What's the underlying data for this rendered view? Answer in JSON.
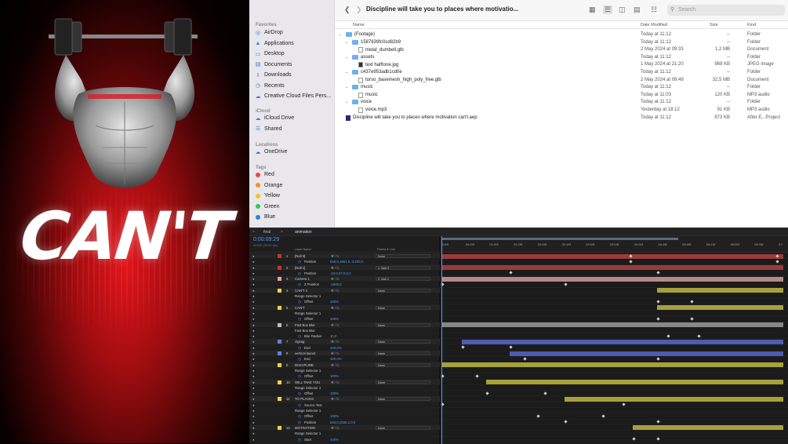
{
  "preview": {
    "headline": "CAN'T"
  },
  "finder": {
    "title": "Discipline will take you to places where motivatio...",
    "search_placeholder": "Search",
    "sidebar": {
      "favorites_label": "Favorites",
      "favorites": [
        "AirDrop",
        "Applications",
        "Desktop",
        "Documents",
        "Downloads",
        "Recents",
        "Creative Cloud Files Pers..."
      ],
      "icloud_label": "iCloud",
      "icloud": [
        "iCloud Drive",
        "Shared"
      ],
      "locations_label": "Locations",
      "locations": [
        "OneDrive"
      ],
      "tags_label": "Tags",
      "tags": [
        {
          "name": "Red",
          "color": "#f0453a"
        },
        {
          "name": "Orange",
          "color": "#f7931e"
        },
        {
          "name": "Yellow",
          "color": "#f5c518"
        },
        {
          "name": "Green",
          "color": "#34c759"
        },
        {
          "name": "Blue",
          "color": "#2f7fe0"
        }
      ]
    },
    "columns": {
      "name": "Name",
      "date": "Date Modified",
      "size": "Size",
      "kind": "Kind"
    },
    "files": [
      {
        "indent": 0,
        "chev": "v",
        "type": "folder",
        "name": "(Footage)",
        "date": "Today at 11:12",
        "size": "--",
        "kind": "Folder"
      },
      {
        "indent": 1,
        "chev": "v",
        "type": "folder",
        "name": "1587639fc0cd82b9",
        "date": "Today at 11:12",
        "size": "--",
        "kind": "Folder"
      },
      {
        "indent": 2,
        "chev": "",
        "type": "doc",
        "name": "metal_dumbell.glb",
        "date": "2 May 2024 at 09:33",
        "size": "1,2 MB",
        "kind": "Document"
      },
      {
        "indent": 1,
        "chev": "v",
        "type": "folder",
        "name": "assets",
        "date": "Today at 11:12",
        "size": "--",
        "kind": "Folder"
      },
      {
        "indent": 2,
        "chev": "",
        "type": "img",
        "name": "text halftone.jpg",
        "date": "1 May 2024 at 21:20",
        "size": "969 KB",
        "kind": "JPEG image"
      },
      {
        "indent": 1,
        "chev": "v",
        "type": "folder",
        "name": "c437e953adb1cd0e",
        "date": "Today at 11:12",
        "size": "--",
        "kind": "Folder"
      },
      {
        "indent": 2,
        "chev": "",
        "type": "doc",
        "name": "torso_basemesh_high_poly_free.glb",
        "date": "2 May 2024 at 09:49",
        "size": "32,5 MB",
        "kind": "Document"
      },
      {
        "indent": 1,
        "chev": "v",
        "type": "folder",
        "name": "music",
        "date": "Today at 11:12",
        "size": "--",
        "kind": "Folder"
      },
      {
        "indent": 2,
        "chev": "",
        "type": "doc",
        "name": "music",
        "date": "Today at 11:03",
        "size": "120 KB",
        "kind": "MP3 audio"
      },
      {
        "indent": 1,
        "chev": "v",
        "type": "folder",
        "name": "voice",
        "date": "Today at 11:12",
        "size": "--",
        "kind": "Folder"
      },
      {
        "indent": 2,
        "chev": "",
        "type": "doc",
        "name": "voice.mp3",
        "date": "Yesterday at 18:12",
        "size": "91 KB",
        "kind": "MP3 audio"
      },
      {
        "indent": 0,
        "chev": "",
        "type": "aep",
        "name": "Discipline will take you to places where motivation can't.aep",
        "date": "Today at 11:12",
        "size": "873 KB",
        "kind": "After E...Project"
      }
    ]
  },
  "ae": {
    "tabs": [
      "final",
      "animation"
    ],
    "timecode": "0:00:09:29",
    "timecode_sub": "00299 (30.00 fps)",
    "header": {
      "layer_name": "Layer Name",
      "parent": "Parent & Link"
    },
    "ruler": [
      "0:00f",
      "00:15f",
      "01:00f",
      "01:15f",
      "02:00f",
      "02:15f",
      "03:00f",
      "03:15f",
      "04:00f",
      "04:15f",
      "05:00f",
      "05:15f",
      "06:00f",
      "06:15f",
      "07:"
    ],
    "rows": [
      {
        "kind": "layer",
        "num": "1",
        "name": "[Null 3]",
        "label": "#c0392b",
        "parent": "None"
      },
      {
        "kind": "prop",
        "name": "Position",
        "value": "540,0,1961,0,-3,200,0"
      },
      {
        "kind": "layer",
        "num": "2",
        "name": "[Null 1]",
        "label": "#c0392b",
        "parent": "1. Null 3"
      },
      {
        "kind": "prop",
        "name": "Position",
        "value": "-10,0,57,0,0,0"
      },
      {
        "kind": "layer",
        "num": "3",
        "name": "Camera 1",
        "label": "#e8a0a0",
        "parent": "2. Null 1"
      },
      {
        "kind": "prop",
        "name": "Z Position",
        "value": "-1500,0"
      },
      {
        "kind": "layer",
        "num": "4",
        "name": "CAN'T 2",
        "label": "#e8d44d",
        "parent": "None"
      },
      {
        "kind": "sub",
        "name": "Range Selector 1"
      },
      {
        "kind": "prop",
        "name": "Offset",
        "value": "100%"
      },
      {
        "kind": "layer",
        "num": "5",
        "name": "CAN'T",
        "label": "#e8d44d",
        "parent": "None"
      },
      {
        "kind": "sub",
        "name": "Range Selector 1"
      },
      {
        "kind": "prop",
        "name": "Offset",
        "value": "100%"
      },
      {
        "kind": "layer",
        "num": "6",
        "name": "Fast Box Blur",
        "label": "#bbbbbb",
        "parent": "None"
      },
      {
        "kind": "sub",
        "name": "Fast Box Blur"
      },
      {
        "kind": "prop",
        "name": "Blur Radius",
        "value": "10,0"
      },
      {
        "kind": "layer",
        "num": "7",
        "name": "zigzag",
        "label": "#6a7fdc",
        "parent": "None"
      },
      {
        "kind": "prop",
        "name": "End",
        "value": "100,0%"
      },
      {
        "kind": "layer",
        "num": "8",
        "name": "vertical layout",
        "label": "#6a7fdc",
        "parent": "None"
      },
      {
        "kind": "prop",
        "name": "End",
        "value": "100,0%"
      },
      {
        "kind": "layer",
        "num": "9",
        "name": "DISCIPLINE",
        "label": "#e8d44d",
        "parent": "None"
      },
      {
        "kind": "sub",
        "name": "Range Selector 1"
      },
      {
        "kind": "prop",
        "name": "Offset",
        "value": "100%"
      },
      {
        "kind": "layer",
        "num": "10",
        "name": "WILL TAKE YOU",
        "label": "#e8d44d",
        "parent": "None"
      },
      {
        "kind": "sub",
        "name": "Range Selector 1"
      },
      {
        "kind": "prop",
        "name": "Offset",
        "value": "100%"
      },
      {
        "kind": "layer",
        "num": "11",
        "name": "TO PLACES",
        "label": "#e8d44d",
        "parent": "None"
      },
      {
        "kind": "prop",
        "name": "Source Text",
        "value": ""
      },
      {
        "kind": "sub",
        "name": "Range Selector 1"
      },
      {
        "kind": "prop",
        "name": "Offset",
        "value": "100%"
      },
      {
        "kind": "prop",
        "name": "Position",
        "value": "540,0,2026,1,0,0"
      },
      {
        "kind": "layer",
        "num": "12",
        "name": "MOTIVATION",
        "label": "#e8d44d",
        "parent": "None"
      },
      {
        "kind": "sub",
        "name": "Range Selector 1"
      },
      {
        "kind": "prop",
        "name": "Start",
        "value": "100%"
      }
    ],
    "tracks": [
      {
        "bar": [
          0,
          100
        ],
        "color": "#9b3a3a",
        "kf": [
          55,
          98
        ]
      },
      {
        "bar": null,
        "kf": [
          55,
          98
        ]
      },
      {
        "bar": [
          0,
          100
        ],
        "color": "#9b3a3a",
        "kf": []
      },
      {
        "bar": null,
        "kf": [
          20,
          63
        ]
      },
      {
        "bar": [
          0,
          100
        ],
        "color": "#b88787",
        "kf": []
      },
      {
        "bar": null,
        "kf": [
          0,
          36
        ]
      },
      {
        "bar": [
          63,
          100
        ],
        "color": "#a6a13a",
        "kf": []
      },
      {
        "bar": null,
        "kf": []
      },
      {
        "bar": null,
        "kf": [
          63,
          73
        ]
      },
      {
        "bar": [
          63,
          100
        ],
        "color": "#a6a13a",
        "kf": []
      },
      {
        "bar": null,
        "kf": []
      },
      {
        "bar": null,
        "kf": [
          63,
          73
        ]
      },
      {
        "bar": [
          0,
          100
        ],
        "color": "#888888",
        "kf": []
      },
      {
        "bar": null,
        "kf": []
      },
      {
        "bar": null,
        "kf": [
          66,
          75
        ]
      },
      {
        "bar": [
          6,
          100
        ],
        "color": "#4d5bb0",
        "kf": []
      },
      {
        "bar": null,
        "kf": [
          6,
          20
        ]
      },
      {
        "bar": [
          20,
          100
        ],
        "color": "#4d5bb0",
        "kf": []
      },
      {
        "bar": null,
        "kf": [
          24,
          63
        ]
      },
      {
        "bar": [
          0,
          100
        ],
        "color": "#a6a13a",
        "kf": []
      },
      {
        "bar": null,
        "kf": []
      },
      {
        "bar": null,
        "kf": [
          0,
          10
        ]
      },
      {
        "bar": [
          13,
          100
        ],
        "color": "#a6a13a",
        "kf": []
      },
      {
        "bar": null,
        "kf": []
      },
      {
        "bar": null,
        "kf": [
          13,
          30
        ]
      },
      {
        "bar": [
          36,
          100
        ],
        "color": "#a6a13a",
        "kf": []
      },
      {
        "bar": null,
        "kf": [
          0,
          53
        ]
      },
      {
        "bar": null,
        "kf": []
      },
      {
        "bar": null,
        "kf": [
          28,
          47
        ]
      },
      {
        "bar": null,
        "kf": [
          36,
          63
        ]
      },
      {
        "bar": [
          56,
          100
        ],
        "color": "#a6a13a",
        "kf": []
      },
      {
        "bar": null,
        "kf": []
      },
      {
        "bar": null,
        "kf": [
          56,
          63
        ]
      }
    ]
  }
}
